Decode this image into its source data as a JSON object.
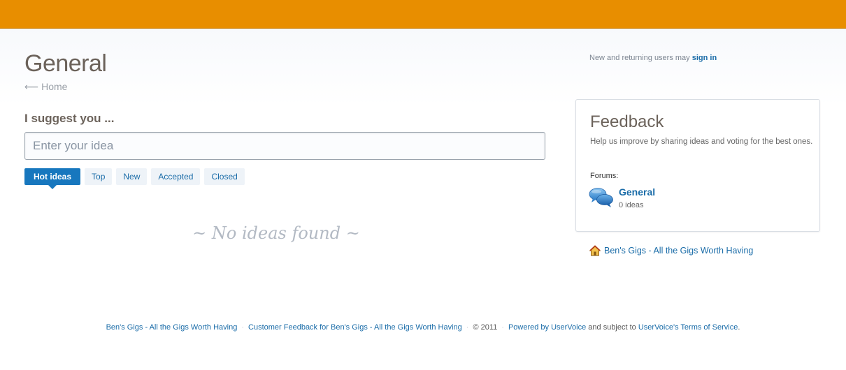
{
  "header": {
    "title": "General",
    "home_link": "Home",
    "home_arrow": "⟵",
    "signin_text": "New and returning users may",
    "signin_link": "sign in"
  },
  "suggest": {
    "label": "I suggest you ...",
    "placeholder": "Enter your idea"
  },
  "tabs": [
    {
      "label": "Hot ideas",
      "active": true
    },
    {
      "label": "Top"
    },
    {
      "label": "New"
    },
    {
      "label": "Accepted"
    },
    {
      "label": "Closed"
    }
  ],
  "empty_message": "~ No ideas found ~",
  "panel": {
    "title": "Feedback",
    "description": "Help us improve by sharing ideas and voting for the best ones.",
    "forums_label": "Forums:",
    "forum": {
      "name": "General",
      "count": "0 ideas",
      "icon": "chat-bubbles-icon"
    }
  },
  "site_link": {
    "label": "Ben's Gigs - All the Gigs Worth Having",
    "icon": "house-icon"
  },
  "footer": {
    "link1": "Ben's Gigs - All the Gigs Worth Having",
    "link2": "Customer Feedback for Ben's Gigs - All the Gigs Worth Having",
    "copyright": "© 2011",
    "powered": "Powered by UserVoice",
    "subject_text": "and subject to",
    "terms": "UserVoice's Terms of Service",
    "period": ".",
    "separator": "·"
  },
  "colors": {
    "topbar": "#e88e00",
    "link": "#1a6ca8",
    "active_tab": "#1777be",
    "title": "#6b625a"
  }
}
